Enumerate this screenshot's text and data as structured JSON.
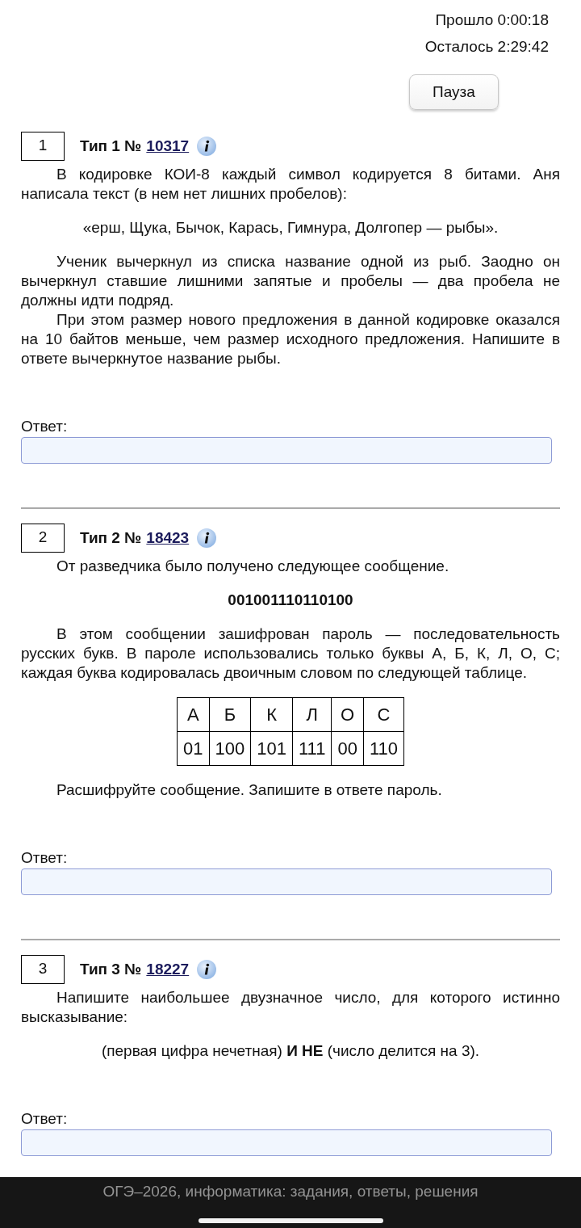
{
  "timer": {
    "elapsed": "Прошло 0:00:18",
    "remaining": "Осталось 2:29:42",
    "pause_button": "Пауза"
  },
  "tasks": [
    {
      "number": "1",
      "type_label": "Тип 1 №",
      "id_link": "10317",
      "body": [
        {
          "kind": "paragraph",
          "text": "В кодировке КОИ-8 каждый символ кодируется 8 битами. Аня написала текст (в нем нет лишних пробелов):"
        },
        {
          "kind": "centered",
          "text": "«ерш, Щука, Бычок, Карась, Гимнура, Долгопер — рыбы»."
        },
        {
          "kind": "paragraph",
          "text": "Ученик вычеркнул из списка название одной из рыб. Заодно он вычеркнул ставшие лишними запятые и пробелы — два пробела не должны идти подряд."
        },
        {
          "kind": "paragraph",
          "text": "При этом размер нового предложения в данной кодировке оказался на 10 байтов меньше, чем размер исходного предложения. Напишите в ответе вычеркнутое название рыбы."
        }
      ],
      "answer_label": "Ответ:"
    },
    {
      "number": "2",
      "type_label": "Тип 2 №",
      "id_link": "18423",
      "body": [
        {
          "kind": "paragraph",
          "text": "От разведчика было получено следующее сообщение."
        },
        {
          "kind": "code",
          "text": "001001110110100"
        },
        {
          "kind": "paragraph",
          "text": "В этом сообщении зашифрован пароль — последовательность русских букв. В пароле использовались только буквы А, Б, К, Л, О, С; каждая буква кодировалась двоичным словом по следующей таблице."
        },
        {
          "kind": "table",
          "rows": [
            [
              "А",
              "Б",
              "К",
              "Л",
              "О",
              "С"
            ],
            [
              "01",
              "100",
              "101",
              "111",
              "00",
              "110"
            ]
          ]
        },
        {
          "kind": "paragraph",
          "text": "Расшифруйте сообщение. Запишите в ответе пароль."
        }
      ],
      "answer_label": "Ответ:"
    },
    {
      "number": "3",
      "type_label": "Тип 3 №",
      "id_link": "18227",
      "body": [
        {
          "kind": "paragraph",
          "text": "Напишите наибольшее двузначное число, для которого истинно высказывание:"
        },
        {
          "kind": "centered",
          "text": "(первая цифра нечетная) **И НЕ** (число делится на 3)."
        }
      ],
      "answer_label": "Ответ:"
    }
  ],
  "footer": {
    "title": "ОГЭ–2026, информатика: задания, ответы, решения"
  }
}
